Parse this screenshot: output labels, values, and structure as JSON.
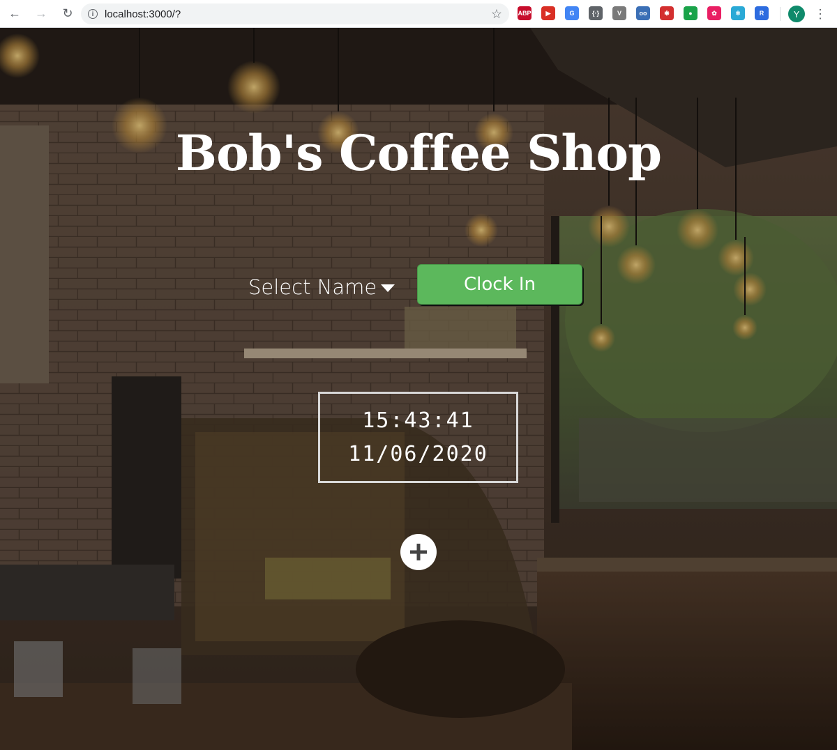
{
  "browser": {
    "url": "localhost:3000/?",
    "avatar_initial": "Y",
    "extensions": [
      {
        "name": "adblock-icon",
        "label": "ABP",
        "color": "#c70d2c"
      },
      {
        "name": "video-speed-icon",
        "label": "▶",
        "color": "#d93025"
      },
      {
        "name": "translate-icon",
        "label": "G",
        "color": "#4285f4"
      },
      {
        "name": "code-icon",
        "label": "{·}",
        "color": "#5f6368"
      },
      {
        "name": "vue-icon",
        "label": "V",
        "color": "#7a7a7a"
      },
      {
        "name": "eyes-icon",
        "label": "oo",
        "color": "#3b6fb6"
      },
      {
        "name": "puzzle-icon",
        "label": "✱",
        "color": "#d32f2f"
      },
      {
        "name": "chat-bubble-icon",
        "label": "●",
        "color": "#1aa34a"
      },
      {
        "name": "color-wheel-icon",
        "label": "✿",
        "color": "#e91e63"
      },
      {
        "name": "react-icon",
        "label": "⚛",
        "color": "#2aa9d6"
      },
      {
        "name": "redux-icon",
        "label": "R",
        "color": "#2d6cdf"
      }
    ]
  },
  "page": {
    "title": "Bob's Coffee Shop",
    "select_label": "Select Name",
    "clock_in_label": "Clock In",
    "time": "15:43:41",
    "date": "11/06/2020",
    "accent_color": "#5cb85c"
  }
}
